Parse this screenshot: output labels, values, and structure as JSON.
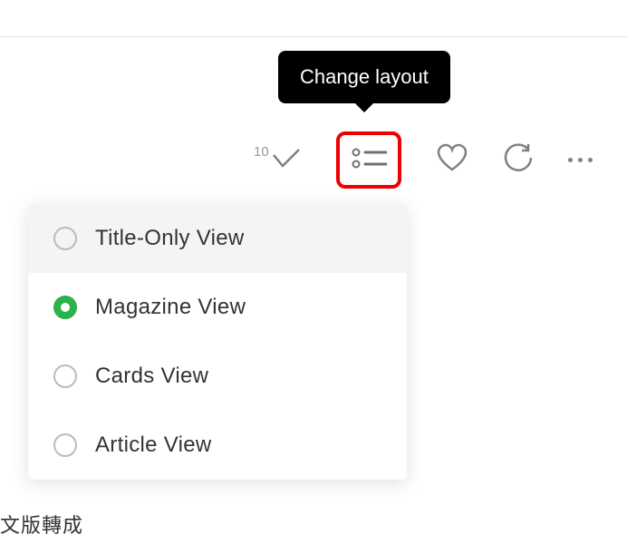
{
  "tooltip": {
    "text": "Change layout"
  },
  "toolbar": {
    "count": "10"
  },
  "dropdown": {
    "items": [
      {
        "label": "Title-Only View",
        "selected": false,
        "hover": true
      },
      {
        "label": "Magazine View",
        "selected": true,
        "hover": false
      },
      {
        "label": "Cards View",
        "selected": false,
        "hover": false
      },
      {
        "label": "Article View",
        "selected": false,
        "hover": false
      }
    ]
  },
  "page_fragment_text": "文版轉成"
}
